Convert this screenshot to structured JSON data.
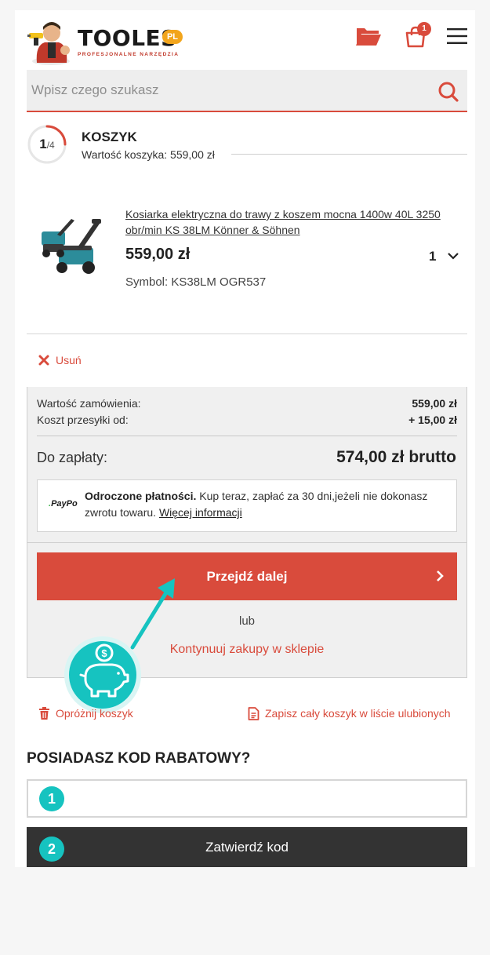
{
  "header": {
    "logo_word": "TOOLES",
    "logo_pl": "PL",
    "logo_tagline": "PROFESJONALNE NARZĘDZIA",
    "cart_count": "1",
    "icons": [
      "folder-icon",
      "shopping-bag-icon",
      "hamburger-menu-icon"
    ]
  },
  "search": {
    "placeholder": "Wpisz czego szukasz",
    "value": ""
  },
  "step": {
    "current": "1",
    "total": "/4",
    "progress": 0.25,
    "title": "KOSZYK",
    "subtitle": "Wartość koszyka: 559,00 zł"
  },
  "product": {
    "name": "Kosiarka elektryczna do trawy z koszem mocna 1400w 40L 3250 obr/min KS 38LM Könner & Söhnen",
    "price": "559,00 zł",
    "quantity": "1",
    "symbol": "Symbol: KS38LM OGR537",
    "remove_label": "Usuń"
  },
  "summary": {
    "order_value_label": "Wartość zamówienia:",
    "order_value": "559,00 zł",
    "shipping_label": "Koszt przesyłki od:",
    "shipping_value": "+ 15,00 zł",
    "to_pay_label": "Do zapłaty:",
    "to_pay_value": "574,00 zł brutto",
    "paypo": {
      "logo": "PayPo",
      "title": "Odroczone płatności.",
      "text": " Kup teraz, zapłać za 30 dni,jeżeli nie dokonasz zwrotu towaru. ",
      "link": "Więcej informacji"
    },
    "proceed_label": "Przejdź dalej",
    "or_label": "lub",
    "continue_label": "Kontynuuj zakupy w sklepie"
  },
  "actions": {
    "empty_cart": "Opróżnij koszyk",
    "save_to_favorites": "Zapisz cały koszyk w liście ulubionych"
  },
  "coupon": {
    "title": "POSIADASZ KOD RABATOWY?",
    "input_value": "",
    "badge_1": "1",
    "badge_2": "2",
    "confirm_label": "Zatwierdź kod"
  },
  "colors": {
    "accent": "#d94b3c",
    "teal": "#16c3c0",
    "dark": "#333333",
    "summary_bg": "#f0f0f0"
  }
}
